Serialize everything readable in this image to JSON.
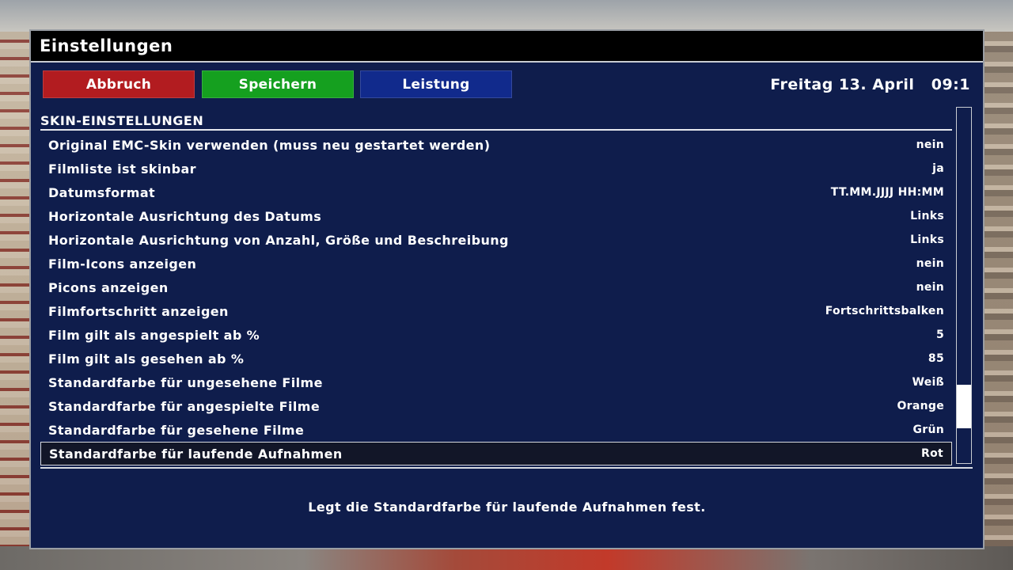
{
  "window": {
    "title": "Einstellungen"
  },
  "buttons": {
    "red": "Abbruch",
    "green": "Speichern",
    "blue": "Leistung"
  },
  "clock": {
    "datetime": "Freitag 13. April   09:1"
  },
  "section": {
    "title": "SKIN-EINSTELLUNGEN"
  },
  "settings": [
    {
      "label": "Original EMC-Skin verwenden (muss neu gestartet werden)",
      "value": "nein"
    },
    {
      "label": "Filmliste ist skinbar",
      "value": "ja"
    },
    {
      "label": "Datumsformat",
      "value": "TT.MM.JJJJ HH:MM"
    },
    {
      "label": "Horizontale Ausrichtung des Datums",
      "value": "Links"
    },
    {
      "label": "Horizontale Ausrichtung von Anzahl, Größe und Beschreibung",
      "value": "Links"
    },
    {
      "label": "Film-Icons anzeigen",
      "value": "nein"
    },
    {
      "label": "Picons anzeigen",
      "value": "nein"
    },
    {
      "label": "Filmfortschritt anzeigen",
      "value": "Fortschrittsbalken"
    },
    {
      "label": "Film gilt als angespielt ab %",
      "value": "5"
    },
    {
      "label": "Film gilt als gesehen ab %",
      "value": "85"
    },
    {
      "label": "Standardfarbe für ungesehene Filme",
      "value": "Weiß"
    },
    {
      "label": "Standardfarbe für angespielte Filme",
      "value": "Orange"
    },
    {
      "label": "Standardfarbe für gesehene Filme",
      "value": "Grün"
    },
    {
      "label": "Standardfarbe für laufende Aufnahmen",
      "value": "Rot"
    }
  ],
  "description": "Legt die Standardfarbe für laufende Aufnahmen fest.",
  "colors": {
    "panel": "#0f1d4c",
    "red": "#b21c20",
    "green": "#15a01f",
    "blue": "#112a8c"
  }
}
